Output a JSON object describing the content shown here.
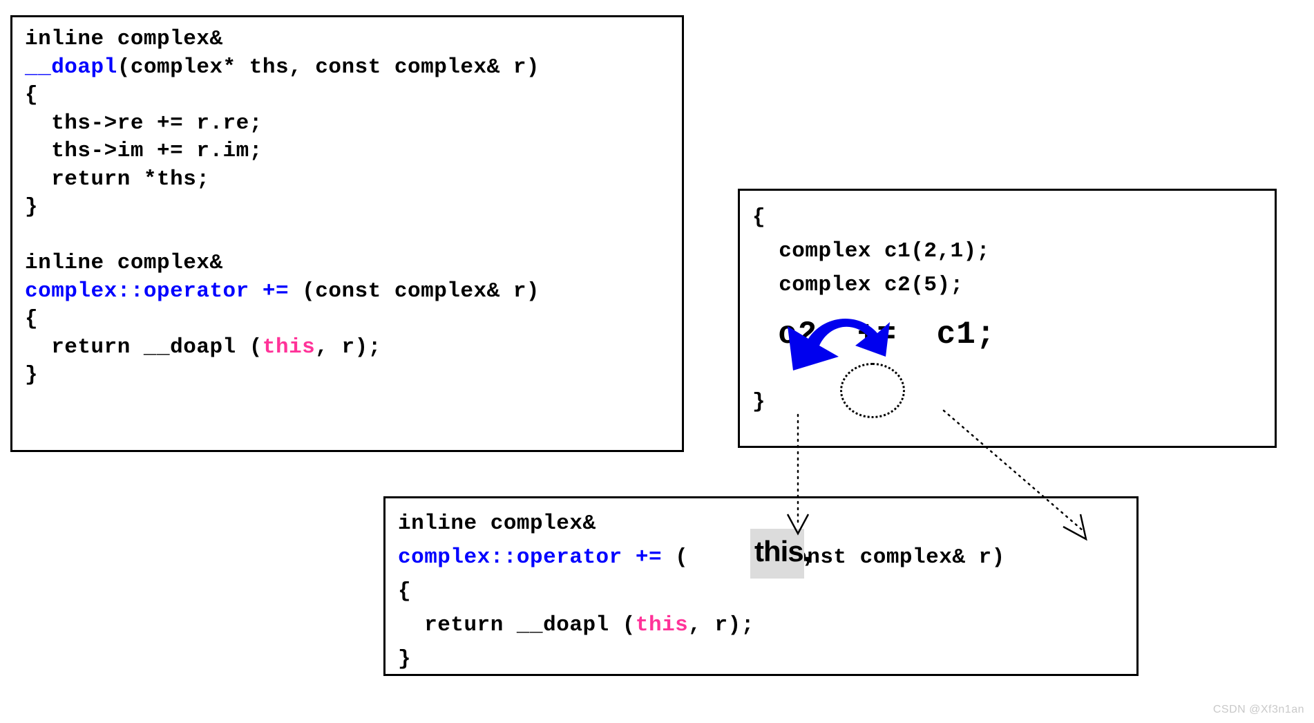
{
  "colors": {
    "keyword_blue": "#0000ff",
    "this_pink": "#ff3399",
    "arrow_blue": "#0000ee",
    "highlight_gray": "#dcdcdc",
    "border_black": "#000000",
    "watermark_gray": "#c9c9c9"
  },
  "left_panel": {
    "line1": "inline complex&",
    "line2_prefix": "__doapl",
    "line2_rest": "(complex* ths, const complex& r)",
    "line3": "{",
    "line4": "  ths->re += r.re;",
    "line5": "  ths->im += r.im;",
    "line6": "  return *ths;",
    "line7": "}",
    "line8": "",
    "line9": "inline complex&",
    "line10_prefix": "complex::operator +=",
    "line10_rest": " (const complex& r)",
    "line11": "{",
    "line12_a": "  return __doapl (",
    "line12_this": "this",
    "line12_b": ", r);",
    "line13": "}"
  },
  "right_panel": {
    "line1": "{",
    "line2": "  complex c1(2,1);",
    "line3": "  complex c2(5);",
    "expression_lhs": "c2",
    "expression_op": "+=",
    "expression_rhs": "c1;",
    "line_close": "}"
  },
  "bottom_panel": {
    "line1": "inline complex&",
    "line2_prefix": "complex::operator +=",
    "line2_open_paren": " (",
    "line2_this": "this,",
    "line2_rest": " const complex& r)",
    "line3": "{",
    "line4_a": "  return __doapl (",
    "line4_this": "this",
    "line4_b": ", r);",
    "line5": "}"
  },
  "annotations": {
    "blue_curved_arrow": "curved-arrow-icon",
    "op_ellipse": "operator-circle-highlight",
    "connector_c2_to_this": "dotted-arrow-c2-to-this",
    "connector_c1_to_r": "dotted-arrow-c1-to-r"
  },
  "watermark": {
    "text": "CSDN @Xf3n1an"
  }
}
